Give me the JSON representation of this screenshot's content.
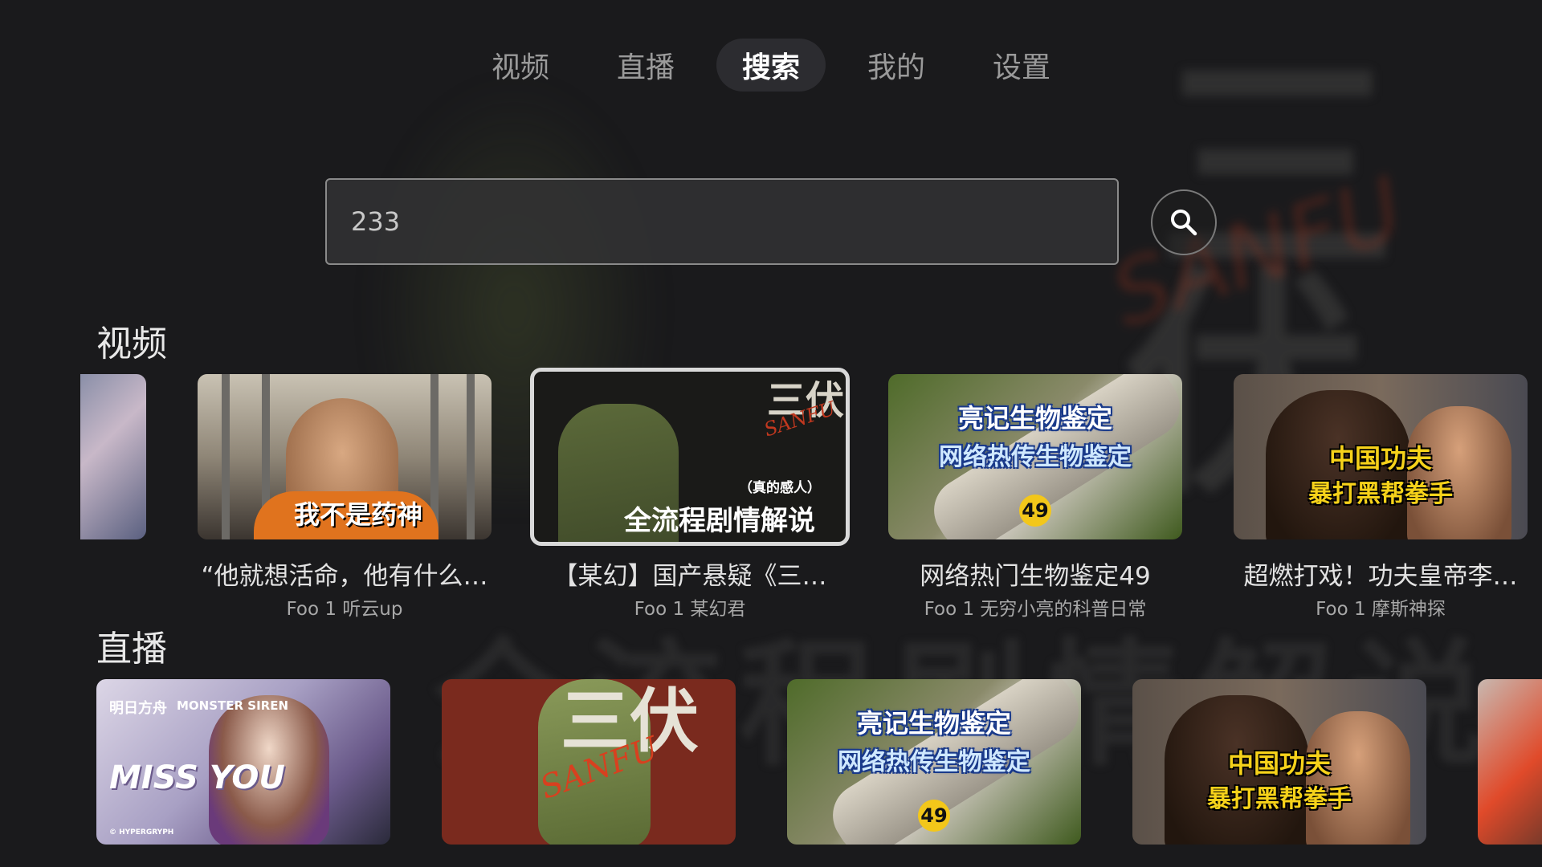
{
  "nav": {
    "tabs": [
      {
        "label": "视频",
        "active": false
      },
      {
        "label": "直播",
        "active": false
      },
      {
        "label": "搜索",
        "active": true
      },
      {
        "label": "我的",
        "active": false
      },
      {
        "label": "设置",
        "active": false
      }
    ]
  },
  "search": {
    "value": "233",
    "button_icon": "search-icon"
  },
  "sections": {
    "video_title": "视频",
    "live_title": "直播"
  },
  "videos": [
    {
      "title": "",
      "subtitle": ""
    },
    {
      "title": "“他就想活命，他有什么…",
      "subtitle": "Foo 1 听云up",
      "thumb_text": "我不是药神"
    },
    {
      "title": "【某幻】国产悬疑《三…",
      "subtitle": "Foo 1 某幻君",
      "thumb": {
        "glyph": "三伏",
        "script": "SANFU",
        "caption_small": "（真的感人）",
        "caption": "全流程剧情解说"
      }
    },
    {
      "title": "网络热门生物鉴定49",
      "subtitle": "Foo 1 无穷小亮的科普日常",
      "thumb": {
        "line1": "亮记生物鉴定",
        "line2": "网络热传生物鉴定",
        "badge": "49"
      }
    },
    {
      "title": "超燃打戏！功夫皇帝李…",
      "subtitle": "Foo 1 摩斯神探",
      "thumb": {
        "line1": "中国功夫",
        "line2": "暴打黑帮拳手"
      }
    }
  ],
  "lives": [
    {
      "thumb": {
        "logo1": "明日方舟",
        "logo2": "MONSTER SIREN",
        "headline": "MISS YOU",
        "footer": "© HYPERGRYPH"
      }
    },
    {
      "thumb": {
        "glyph": "三伏",
        "script": "SANFU"
      }
    },
    {
      "thumb": {
        "line1": "亮记生物鉴定",
        "line2": "网络热传生物鉴定",
        "badge": "49"
      }
    },
    {
      "thumb": {
        "line1": "中国功夫",
        "line2": "暴打黑帮拳手"
      }
    },
    {
      "thumb": {}
    }
  ],
  "colors": {
    "background": "#1a1a1c",
    "active_tab_bg": "#2c2c30",
    "focus_border": "#d9d9d9",
    "badge_yellow": "#f3c71a",
    "kungfu_yellow": "#f6d21a",
    "sanfu_red": "#c0381f"
  }
}
